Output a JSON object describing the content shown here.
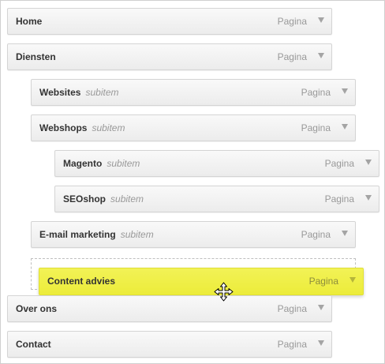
{
  "menu": {
    "items": [
      {
        "title": "Home",
        "subtitle": "",
        "type": "Pagina"
      },
      {
        "title": "Diensten",
        "subtitle": "",
        "type": "Pagina"
      },
      {
        "title": "Websites",
        "subtitle": "subitem",
        "type": "Pagina"
      },
      {
        "title": "Webshops",
        "subtitle": "subitem",
        "type": "Pagina"
      },
      {
        "title": "Magento",
        "subtitle": "subitem",
        "type": "Pagina"
      },
      {
        "title": "SEOshop",
        "subtitle": "subitem",
        "type": "Pagina"
      },
      {
        "title": "E-mail marketing",
        "subtitle": "subitem",
        "type": "Pagina"
      },
      {
        "title": "Over ons",
        "subtitle": "",
        "type": "Pagina"
      },
      {
        "title": "Contact",
        "subtitle": "",
        "type": "Pagina"
      }
    ],
    "dragging": {
      "title": "Content advies",
      "type": "Pagina"
    }
  },
  "icons": {
    "dropdown": "triangle-down-icon",
    "cursor": "move-cursor-icon"
  },
  "colors": {
    "highlight": "#f0f04a",
    "item_bg": "#f2f2f2",
    "border": "#d4d4d4"
  }
}
